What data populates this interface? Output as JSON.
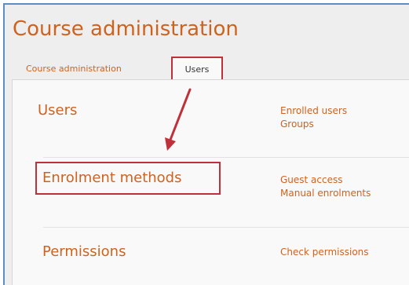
{
  "header": {
    "title": "Course administration"
  },
  "tabs": [
    {
      "label": "Course administration"
    },
    {
      "label": "Users"
    }
  ],
  "sections": [
    {
      "heading": "Users",
      "links": [
        "Enrolled users",
        "Groups"
      ]
    },
    {
      "heading": "Enrolment methods",
      "links": [
        "Guest access",
        "Manual enrolments"
      ]
    },
    {
      "heading": "Permissions",
      "links": [
        "Check permissions"
      ]
    }
  ],
  "colors": {
    "accent": "#d0621d",
    "annotation": "#c0303b",
    "border": "#5b8ec7"
  }
}
